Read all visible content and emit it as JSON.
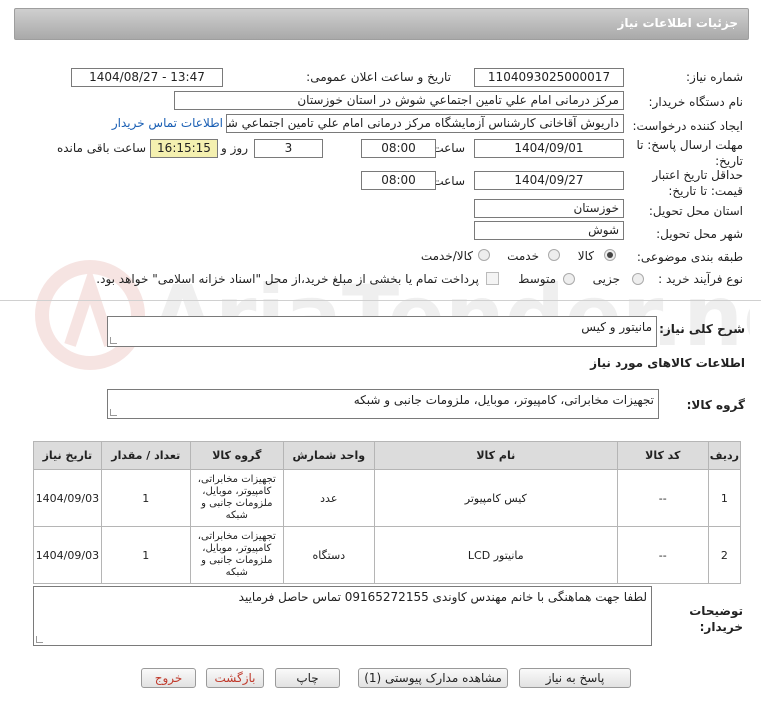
{
  "header": {
    "title": "جزئیات اطلاعات نیاز"
  },
  "form": {
    "need_number_label": "شماره نیاز:",
    "need_number": "1104093025000017",
    "announce_label": "تاریخ و ساعت اعلان عمومی:",
    "announce_value": "1404/08/27 - 13:47",
    "buyer_org_label": "نام دستگاه خریدار:",
    "buyer_org": "مرکز درمانی امام علي تامين اجتماعي شوش در استان خوزستان",
    "creator_label": "ایجاد کننده درخواست:",
    "creator": "داریوش آقاخانی کارشناس آزمایشگاه مرکز درمانی امام علي تامين اجتماعي شو",
    "contact_link": "اطلاعات تماس خریدار",
    "deadline_label": "مهلت ارسال پاسخ: تا تاریخ:",
    "deadline_date": "1404/09/01",
    "time_word": "ساعت",
    "deadline_time": "08:00",
    "days": "3",
    "days_word": "روز و",
    "remaining_time": "16:15:15",
    "remaining_label": "ساعت باقی مانده",
    "validity_label": "حداقل تاریخ اعتبار قیمت: تا تاریخ:",
    "validity_date": "1404/09/27",
    "validity_time": "08:00",
    "province_label": "استان محل تحویل:",
    "province": "خوزستان",
    "city_label": "شهر محل تحویل:",
    "city": "شوش",
    "category_label": "طبقه بندی موضوعی:",
    "category_options": [
      "کالا",
      "خدمت",
      "کالا/خدمت"
    ],
    "process_label": "نوع فرآیند خرید :",
    "process_options": [
      "جزیی",
      "متوسط"
    ],
    "payment_note": "پرداخت تمام یا بخشی از مبلغ خرید،از محل \"اسناد خزانه اسلامی\" خواهد بود."
  },
  "summary": {
    "label": "شرح کلی نیاز:",
    "value": "مانیتور و کیس"
  },
  "goods_info": {
    "title": "اطلاعات کالاهای مورد نیاز",
    "group_label": "گروه کالا:",
    "group_value": "تجهیزات مخابراتی، کامپیوتر، موبایل، ملزومات جانبی و شبکه"
  },
  "table": {
    "headers": [
      "ردیف",
      "کد کالا",
      "نام کالا",
      "واحد شمارش",
      "گروه کالا",
      "تعداد / مقدار",
      "تاریخ نیاز"
    ],
    "rows": [
      [
        "1",
        "--",
        "کیس کامپیوتر",
        "عدد",
        "تجهیزات مخابراتی، کامپیوتر، موبایل، ملزومات جانبی و شبکه",
        "1",
        "1404/09/03"
      ],
      [
        "2",
        "--",
        "مانیتور LCD",
        "دستگاه",
        "تجهیزات مخابراتی، کامپیوتر، موبایل، ملزومات جانبی و شبکه",
        "1",
        "1404/09/03"
      ]
    ]
  },
  "notes": {
    "label": "توضیحات خریدار:",
    "value": "لطفا جهت هماهنگی با خانم مهندس کاوندی 09165272155 تماس حاصل فرمایید"
  },
  "buttons": {
    "reply": "پاسخ به نیاز",
    "attachments": "مشاهده مدارک پیوستی (1)",
    "print": "چاپ",
    "back": "بازگشت",
    "exit": "خروج"
  },
  "watermark": {
    "text": "AriaTender.neT"
  }
}
